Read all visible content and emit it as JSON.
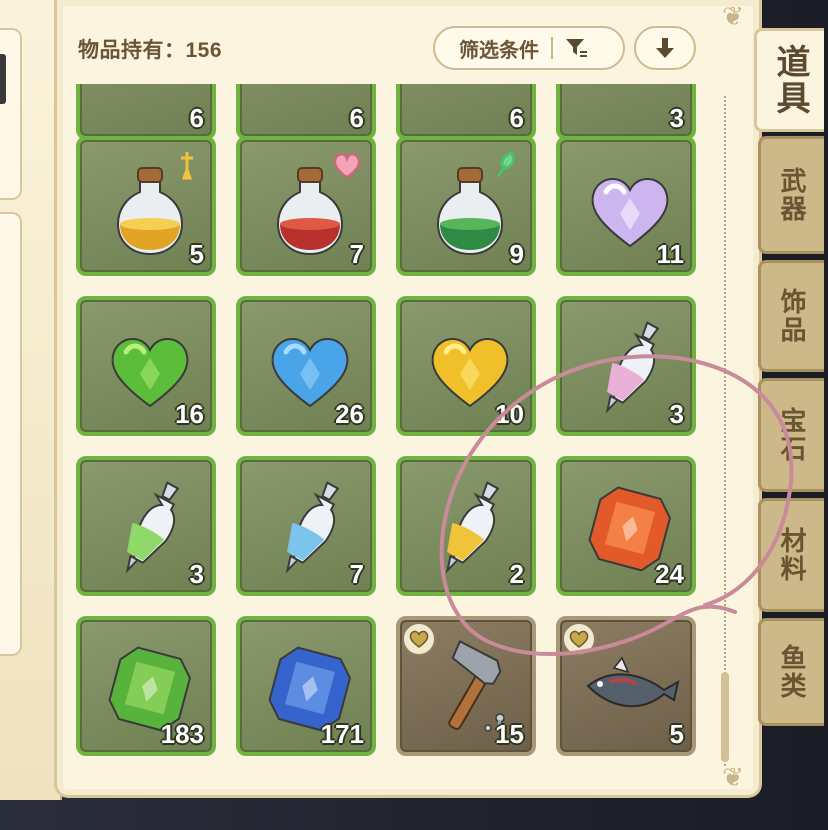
{
  "header": {
    "item_count_label": "物品持有：156",
    "filter_label": "筛选条件",
    "filter_icon": "filter-icon",
    "sort_icon": "arrow-down-icon"
  },
  "tabs": [
    {
      "label": "道具",
      "active": true
    },
    {
      "label": "武器",
      "active": false
    },
    {
      "label": "饰品",
      "active": false
    },
    {
      "label": "宝石",
      "active": false
    },
    {
      "label": "材料",
      "active": false
    },
    {
      "label": "鱼类",
      "active": false
    }
  ],
  "items": [
    {
      "icon": "crate",
      "qty": "6"
    },
    {
      "icon": "crate",
      "qty": "6"
    },
    {
      "icon": "crate",
      "qty": "6"
    },
    {
      "icon": "blue-orb",
      "qty": "3"
    },
    {
      "icon": "yellow-potion",
      "qty": "5",
      "tag": "sword-tag-icon"
    },
    {
      "icon": "red-potion",
      "qty": "7",
      "tag": "heart-tag-icon"
    },
    {
      "icon": "green-potion",
      "qty": "9",
      "tag": "leaf-tag-icon"
    },
    {
      "icon": "rainbow-heart",
      "qty": "11"
    },
    {
      "icon": "green-heart",
      "qty": "16"
    },
    {
      "icon": "blue-heart",
      "qty": "26"
    },
    {
      "icon": "yellow-heart",
      "qty": "10"
    },
    {
      "icon": "pink-vial",
      "qty": "3"
    },
    {
      "icon": "green-vial",
      "qty": "3"
    },
    {
      "icon": "blue-vial",
      "qty": "7"
    },
    {
      "icon": "yellow-vial",
      "qty": "2"
    },
    {
      "icon": "red-gem",
      "qty": "24"
    },
    {
      "icon": "green-gem",
      "qty": "183"
    },
    {
      "icon": "blue-gem",
      "qty": "171"
    },
    {
      "icon": "hammer",
      "qty": "15",
      "favorite": true
    },
    {
      "icon": "fish",
      "qty": "5",
      "favorite": true
    }
  ],
  "colors": {
    "slot_green": "#6fb441",
    "slot_brown": "#a89878",
    "annotation": "#c98a9a"
  }
}
